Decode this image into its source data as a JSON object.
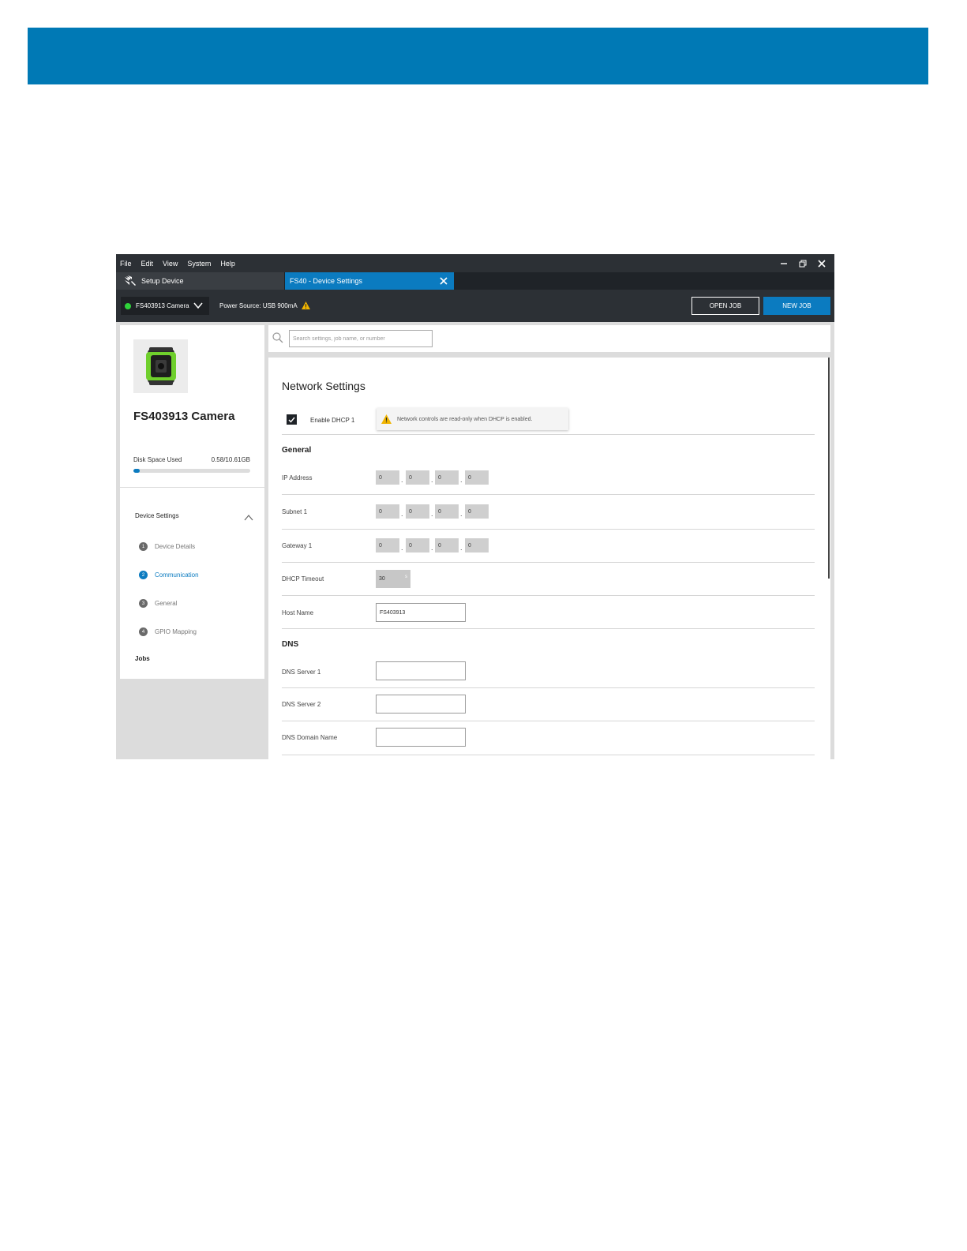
{
  "menu": [
    "File",
    "Edit",
    "View",
    "System",
    "Help"
  ],
  "tabs": {
    "setup": "Setup Device",
    "device_settings": "FS40 - Device Settings"
  },
  "device_bar": {
    "device": "FS403913 Camera",
    "power": "Power Source: USB 900mA",
    "open_job": "OPEN JOB",
    "new_job": "NEW JOB"
  },
  "sidebar": {
    "device_name": "FS403913 Camera",
    "disk_label": "Disk Space Used",
    "disk_value": "0.58/10.61GB",
    "disk_used_fraction": 0.055,
    "section": "Device Settings",
    "items": [
      {
        "num": "1",
        "label": "Device Details"
      },
      {
        "num": "2",
        "label": "Communication"
      },
      {
        "num": "3",
        "label": "General"
      },
      {
        "num": "4",
        "label": "GPIO Mapping"
      }
    ],
    "jobs": "Jobs"
  },
  "search": {
    "placeholder": "Search settings, job name, or number"
  },
  "network": {
    "title": "Network Settings",
    "dhcp_label": "Enable DHCP 1",
    "notice": "Network controls are read-only when DHCP is enabled.",
    "general_title": "General",
    "ip_label": "IP Address",
    "ip": [
      "0",
      "0",
      "0",
      "0"
    ],
    "subnet_label": "Subnet 1",
    "subnet": [
      "0",
      "0",
      "0",
      "0"
    ],
    "gateway_label": "Gateway 1",
    "gateway": [
      "0",
      "0",
      "0",
      "0"
    ],
    "timeout_label": "DHCP Timeout",
    "timeout_value": "30",
    "timeout_unit": "s",
    "hostname_label": "Host Name",
    "hostname_value": "FS403913",
    "dns_title": "DNS",
    "dns1_label": "DNS Server 1",
    "dns1_value": "",
    "dns2_label": "DNS Server 2",
    "dns2_value": "",
    "domain_label": "DNS Domain Name",
    "domain_value": ""
  },
  "colors": {
    "accent": "#0b7bc0",
    "banner": "#0079b5",
    "status_online": "#2fd33a",
    "warning": "#f0b400"
  }
}
